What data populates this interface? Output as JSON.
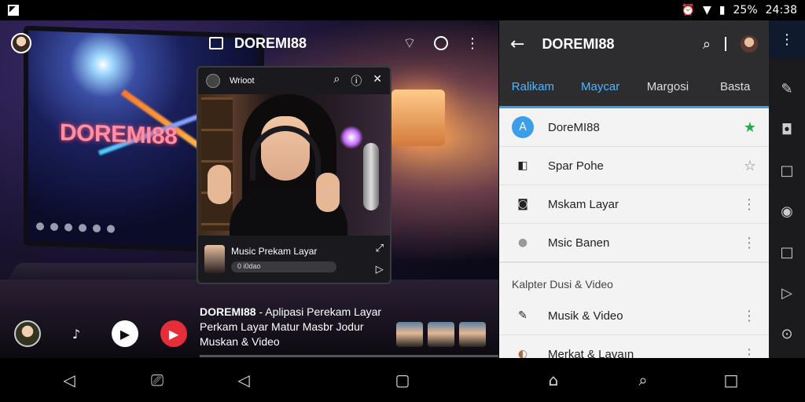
{
  "status_bar": {
    "battery": "25%",
    "time": "24:38"
  },
  "header": {
    "title": "DOREMI88"
  },
  "monitor": {
    "brand": "DOREMI88"
  },
  "pip": {
    "title": "Wrioot",
    "footer_title": "Music Prekam Layar",
    "footer_sub": "0 i0dao"
  },
  "video": {
    "caption_title": "DOREMI88",
    "caption_rest": " - Aplipasi Perekam Layar Perkam Layar Matur Masbr Jodur Muskan & Video"
  },
  "right_panel": {
    "title": "DOREMI88",
    "tabs": [
      {
        "label": "Ralikam"
      },
      {
        "label": "Maycar"
      },
      {
        "label": "Margosi"
      },
      {
        "label": "Basta"
      }
    ],
    "items": [
      {
        "label": "DoreMI88",
        "icon": "A",
        "trail": "★"
      },
      {
        "label": "Spar Pohe",
        "icon": "◧",
        "trail": "☆"
      },
      {
        "label": "Mskam Layar",
        "icon": "◙",
        "trail": "⋮"
      },
      {
        "label": "Msic Banen",
        "icon": "●",
        "trail": "⋮"
      }
    ],
    "section_label": "Kalpter Dusi & Video",
    "section_items": [
      {
        "label": "Musik & Video",
        "icon": "✎",
        "trail": "⋮"
      },
      {
        "label": "Merkat & Lavaın",
        "icon": "◐",
        "trail": "⋮"
      }
    ]
  },
  "colors": {
    "accent": "#3aa0e8",
    "star_green": "#2aa84a",
    "record_red": "#e62d3a"
  }
}
